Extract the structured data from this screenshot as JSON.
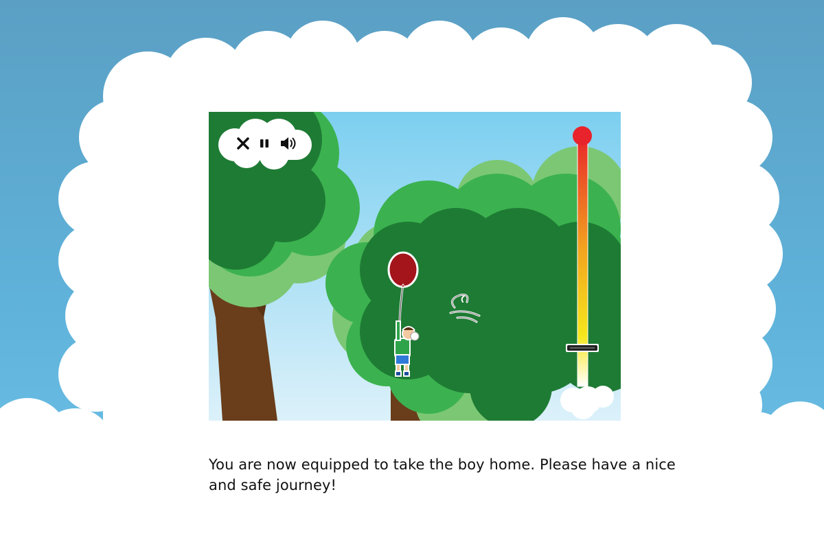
{
  "caption": {
    "text": "You are now equipped to take the boy home. Please have a nice and safe journey!"
  },
  "hud": {
    "buttons": [
      {
        "name": "close-button",
        "icon": "close-icon"
      },
      {
        "name": "pause-button",
        "icon": "pause-icon"
      },
      {
        "name": "sound-button",
        "icon": "speaker-icon"
      }
    ]
  },
  "altitude_meter": {
    "gradient": [
      "#e8232b",
      "#f2a21f",
      "#f6e71c",
      "#ffffff"
    ]
  },
  "colors": {
    "sky_top": "#5b9fc4",
    "foliage_dark": "#1e7b34",
    "foliage_mid": "#3bb24f",
    "foliage_light": "#7cc774",
    "trunk": "#6a3d1b",
    "balloon": "#a3141b"
  }
}
